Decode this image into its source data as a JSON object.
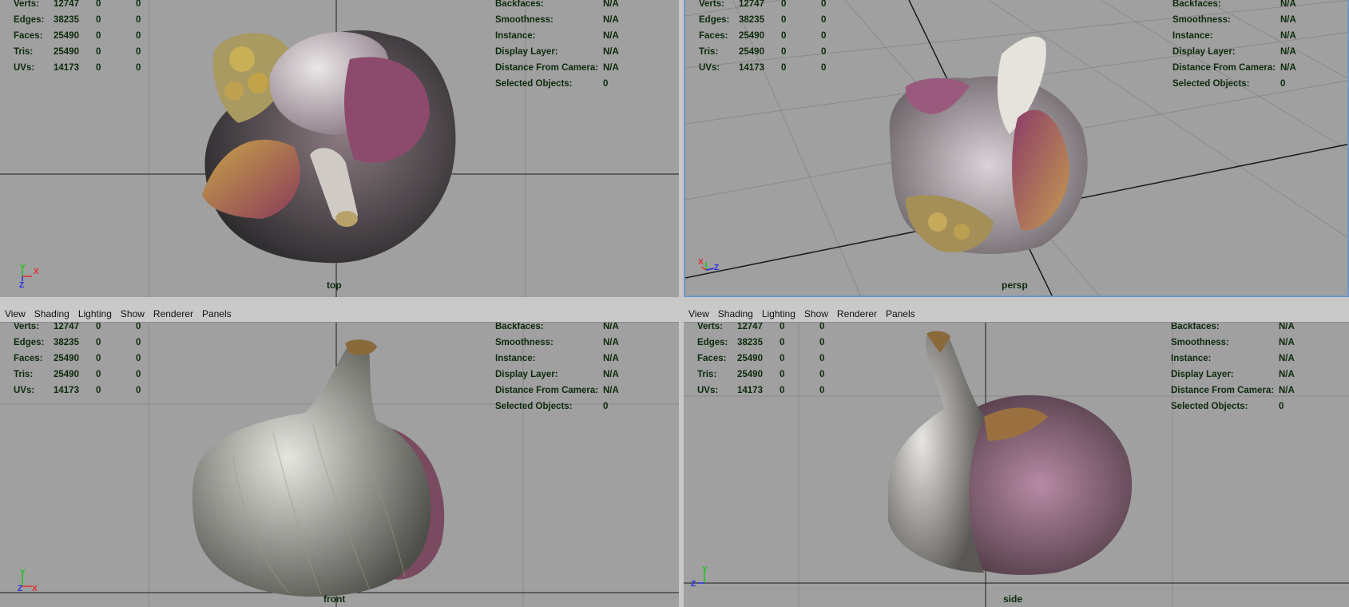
{
  "menu": [
    "View",
    "Shading",
    "Lighting",
    "Show",
    "Renderer",
    "Panels"
  ],
  "stats": [
    {
      "label": "Verts:",
      "v": "12747",
      "a": "0",
      "b": "0"
    },
    {
      "label": "Edges:",
      "v": "38235",
      "a": "0",
      "b": "0"
    },
    {
      "label": "Faces:",
      "v": "25490",
      "a": "0",
      "b": "0"
    },
    {
      "label": "Tris:",
      "v": "25490",
      "a": "0",
      "b": "0"
    },
    {
      "label": "UVs:",
      "v": "14173",
      "a": "0",
      "b": "0"
    }
  ],
  "info": [
    {
      "label": "Backfaces:",
      "v": "N/A"
    },
    {
      "label": "Smoothness:",
      "v": "N/A"
    },
    {
      "label": "Instance:",
      "v": "N/A"
    },
    {
      "label": "Display Layer:",
      "v": "N/A"
    },
    {
      "label": "Distance From Camera:",
      "v": "N/A"
    },
    {
      "label": "Selected Objects:",
      "v": "0"
    }
  ],
  "panes": {
    "top": {
      "camera": "top",
      "axis1": "Y",
      "axis2": "X",
      "axis3": "Z"
    },
    "persp": {
      "camera": "persp",
      "axis1": "X",
      "axis2": "Z"
    },
    "front": {
      "camera": "front",
      "axis1": "Y",
      "axis2": "Z",
      "axis3": "X"
    },
    "side": {
      "camera": "side",
      "axis1": "Y",
      "axis2": "Z"
    }
  },
  "colors": {
    "viewport": "#a0a0a0",
    "hud_text": "#0c2a0c",
    "active_border": "#6f95c9",
    "grid": "#8a8a8a",
    "axis_line": "#1a1a1a"
  }
}
